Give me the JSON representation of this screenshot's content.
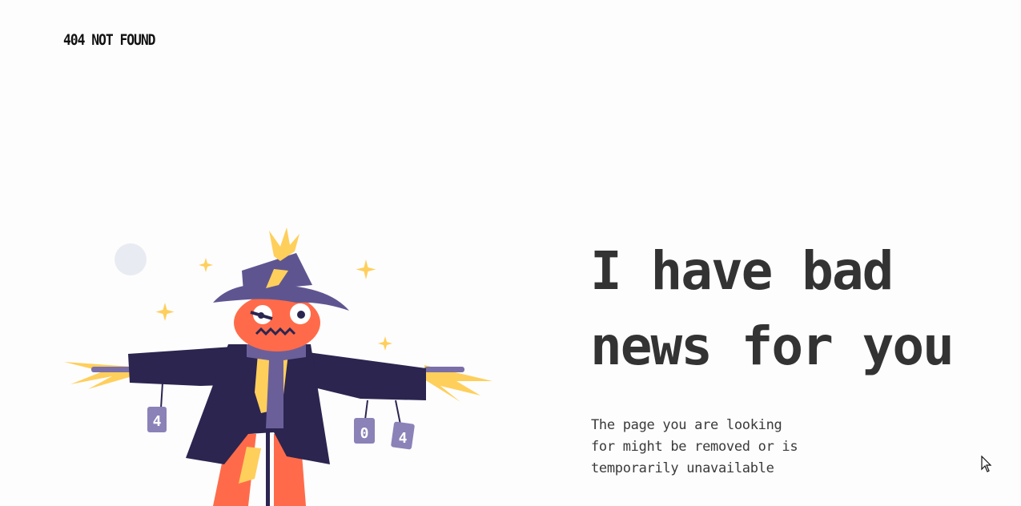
{
  "brand": {
    "label": "404 NOT FOUND"
  },
  "hero": {
    "headline_line1": "I have bad",
    "headline_line2": "news for you",
    "message": "The page you are looking for might be removed or is temporarily unavailable"
  },
  "illustration": {
    "can_left": "4",
    "can_middle": "0",
    "can_right": "4"
  },
  "colors": {
    "background": "#fdfdfd",
    "text": "#333333",
    "coat": "#2b2550",
    "hat": "#5e5590",
    "face": "#ff6b4a",
    "straw": "#ffcf5c",
    "can": "#8b82b8",
    "moon": "#e8ebf2"
  }
}
